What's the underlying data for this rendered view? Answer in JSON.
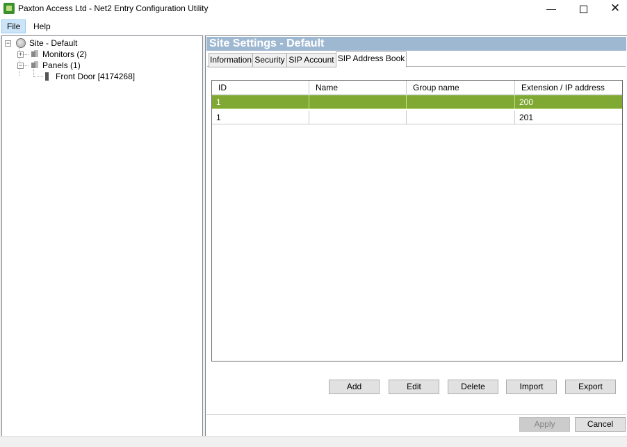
{
  "window": {
    "title": "Paxton Access Ltd - Net2 Entry Configuration Utility",
    "controls": {
      "minimize": "—",
      "close": "✕"
    }
  },
  "menu": {
    "file": "File",
    "help": "Help"
  },
  "tree": {
    "site": "Site - Default",
    "monitors": "Monitors (2)",
    "panels": "Panels (1)",
    "front_door": "Front Door [4174268]",
    "expand_plus": "+",
    "expand_minus": "−"
  },
  "panel": {
    "title": "Site Settings - Default",
    "tabs": [
      "Information",
      "Security",
      "SIP Account",
      "SIP Address Book"
    ],
    "active_tab": "SIP Address Book",
    "selection_color": "#80a934"
  },
  "table": {
    "columns": [
      "ID",
      "Name",
      "Group name",
      "Extension / IP address"
    ],
    "rows": [
      {
        "id": "1",
        "name": "",
        "group": "",
        "extension": "200",
        "selected": true
      },
      {
        "id": "1",
        "name": "",
        "group": "",
        "extension": "201",
        "selected": false
      }
    ]
  },
  "actions": {
    "add": "Add",
    "edit": "Edit",
    "delete": "Delete",
    "import": "Import",
    "export": "Export"
  },
  "footer": {
    "apply": "Apply",
    "cancel": "Cancel"
  }
}
